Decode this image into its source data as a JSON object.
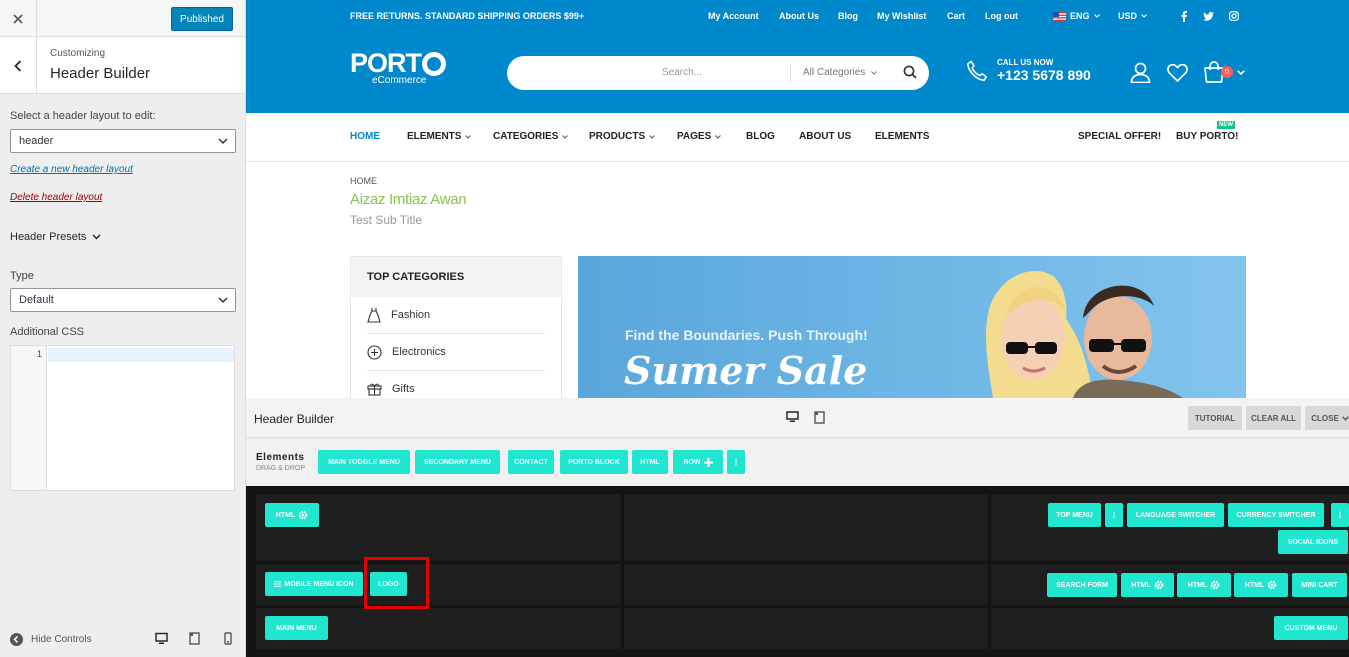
{
  "customizer": {
    "published_label": "Published",
    "customizing_label": "Customizing",
    "section_title": "Header Builder",
    "select_layout_label": "Select a header layout to edit:",
    "layout_value": "header",
    "create_link": "Create a new header layout",
    "delete_link": "Delete header layout",
    "presets_label": "Header Presets",
    "type_label": "Type",
    "type_value": "Default",
    "css_label": "Additional CSS",
    "css_line_number": "1",
    "hide_controls": "Hide Controls",
    "link_color": "#0073aa",
    "delete_color": "#a00000"
  },
  "site": {
    "promo": "FREE RETURNS. STANDARD SHIPPING ORDERS $99+",
    "top_links": [
      "My Account",
      "About Us",
      "Blog",
      "My Wishlist",
      "Cart",
      "Log out"
    ],
    "language": "ENG",
    "currency": "USD",
    "logo_text": "PORT",
    "logo_sub": "eCommerce",
    "search_placeholder": "Search...",
    "search_category": "All Categories",
    "call_label": "CALL US NOW",
    "call_number": "+123 5678 890",
    "cart_count": "0",
    "brand_color": "#0088cc",
    "nav": [
      "HOME",
      "ELEMENTS",
      "CATEGORIES",
      "PRODUCTS",
      "PAGES",
      "BLOG",
      "ABOUT US",
      "ELEMENTS"
    ],
    "special_offer": "SPECIAL OFFER!",
    "buy_porto": "BUY PORTO!",
    "new_badge": "NEW",
    "breadcrumb": "HOME",
    "page_title": "Aizaz Imtiaz Awan",
    "page_subtitle": "Test Sub Title",
    "top_categories_title": "TOP CATEGORIES",
    "categories": [
      "Fashion",
      "Electronics",
      "Gifts"
    ],
    "banner_line1": "Find the Boundaries. Push Through!",
    "banner_line2": "Sumer Sale"
  },
  "builder": {
    "title": "Header Builder",
    "tutorial": "TUTORIAL",
    "clear_all": "CLEAR ALL",
    "close": "CLOSE",
    "elements_title": "Elements",
    "elements_sub": "DRAG & DROP",
    "elements": [
      "MAIN TOGGLE MENU",
      "SECONDARY MENU",
      "CONTACT",
      "PORTO BLOCK",
      "HTML",
      "ROW",
      "|"
    ],
    "row1_left": [
      "HTML"
    ],
    "row1_right": [
      "TOP MENU",
      "|",
      "LANGUAGE SWITCHER",
      "CURRENCY SWITCHER",
      "|",
      "SOCIAL ICONS"
    ],
    "row2_left": [
      "MOBILE MENU ICON",
      "LOGO"
    ],
    "row2_right": [
      "SEARCH FORM",
      "HTML",
      "HTML",
      "HTML",
      "MINI CART"
    ],
    "row3_left": [
      "MAIN MENU"
    ],
    "row3_right": [
      "CUSTOM MENU"
    ],
    "chip_color": "#20e5cf"
  }
}
